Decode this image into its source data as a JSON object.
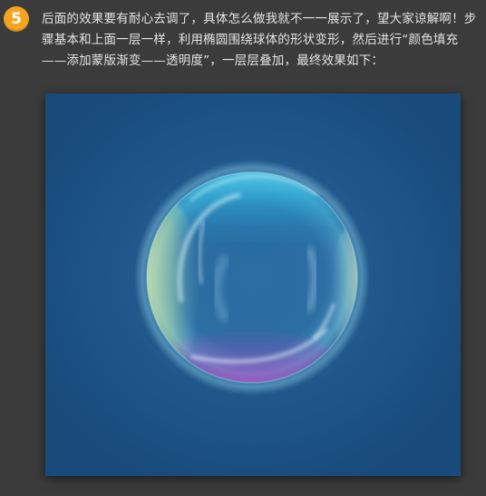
{
  "step": {
    "number": "5"
  },
  "intro": {
    "text": "后面的效果要有耐心去调了，具体怎么做我就不一一展示了，望大家谅解啊！步骤基本和上面一层一样，利用椭圆围绕球体的形状变形，然后进行“颜色填充——添加蒙版渐变——透明度”，一层层叠加，最终效果如下："
  },
  "colors": {
    "page_background": "#3b3b3b",
    "badge": "#f5a41f",
    "text": "#e4e4e4",
    "artwork_background": "#1c5083",
    "bubble_cyan": "#4fd6f0",
    "bubble_yellow": "#e8f4a0",
    "bubble_magenta": "#c04bc8"
  },
  "icons": {
    "step_badge": "circled-number-icon",
    "artwork": "soap-bubble-illustration"
  }
}
